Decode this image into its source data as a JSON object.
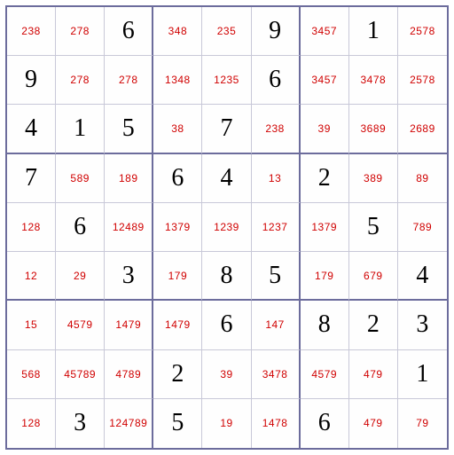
{
  "grid": [
    [
      {
        "t": "c",
        "v": "238"
      },
      {
        "t": "c",
        "v": "278"
      },
      {
        "t": "g",
        "v": "6"
      },
      {
        "t": "c",
        "v": "348"
      },
      {
        "t": "c",
        "v": "235"
      },
      {
        "t": "g",
        "v": "9"
      },
      {
        "t": "c",
        "v": "3457"
      },
      {
        "t": "g",
        "v": "1"
      },
      {
        "t": "c",
        "v": "2578"
      }
    ],
    [
      {
        "t": "g",
        "v": "9"
      },
      {
        "t": "c",
        "v": "278"
      },
      {
        "t": "c",
        "v": "278"
      },
      {
        "t": "c",
        "v": "1348"
      },
      {
        "t": "c",
        "v": "1235"
      },
      {
        "t": "g",
        "v": "6"
      },
      {
        "t": "c",
        "v": "3457"
      },
      {
        "t": "c",
        "v": "3478"
      },
      {
        "t": "c",
        "v": "2578"
      }
    ],
    [
      {
        "t": "g",
        "v": "4"
      },
      {
        "t": "g",
        "v": "1"
      },
      {
        "t": "g",
        "v": "5"
      },
      {
        "t": "c",
        "v": "38"
      },
      {
        "t": "g",
        "v": "7"
      },
      {
        "t": "c",
        "v": "238"
      },
      {
        "t": "c",
        "v": "39"
      },
      {
        "t": "c",
        "v": "3689"
      },
      {
        "t": "c",
        "v": "2689"
      }
    ],
    [
      {
        "t": "g",
        "v": "7"
      },
      {
        "t": "c",
        "v": "589"
      },
      {
        "t": "c",
        "v": "189"
      },
      {
        "t": "g",
        "v": "6"
      },
      {
        "t": "g",
        "v": "4"
      },
      {
        "t": "c",
        "v": "13"
      },
      {
        "t": "g",
        "v": "2"
      },
      {
        "t": "c",
        "v": "389"
      },
      {
        "t": "c",
        "v": "89"
      }
    ],
    [
      {
        "t": "c",
        "v": "128"
      },
      {
        "t": "g",
        "v": "6"
      },
      {
        "t": "c",
        "v": "12489"
      },
      {
        "t": "c",
        "v": "1379"
      },
      {
        "t": "c",
        "v": "1239"
      },
      {
        "t": "c",
        "v": "1237"
      },
      {
        "t": "c",
        "v": "1379"
      },
      {
        "t": "g",
        "v": "5"
      },
      {
        "t": "c",
        "v": "789"
      }
    ],
    [
      {
        "t": "c",
        "v": "12"
      },
      {
        "t": "c",
        "v": "29"
      },
      {
        "t": "g",
        "v": "3"
      },
      {
        "t": "c",
        "v": "179"
      },
      {
        "t": "g",
        "v": "8"
      },
      {
        "t": "g",
        "v": "5"
      },
      {
        "t": "c",
        "v": "179"
      },
      {
        "t": "c",
        "v": "679"
      },
      {
        "t": "g",
        "v": "4"
      }
    ],
    [
      {
        "t": "c",
        "v": "15"
      },
      {
        "t": "c",
        "v": "4579"
      },
      {
        "t": "c",
        "v": "1479"
      },
      {
        "t": "c",
        "v": "1479"
      },
      {
        "t": "g",
        "v": "6"
      },
      {
        "t": "c",
        "v": "147"
      },
      {
        "t": "g",
        "v": "8"
      },
      {
        "t": "g",
        "v": "2"
      },
      {
        "t": "g",
        "v": "3"
      }
    ],
    [
      {
        "t": "c",
        "v": "568"
      },
      {
        "t": "c",
        "v": "45789"
      },
      {
        "t": "c",
        "v": "4789"
      },
      {
        "t": "g",
        "v": "2"
      },
      {
        "t": "c",
        "v": "39"
      },
      {
        "t": "c",
        "v": "3478"
      },
      {
        "t": "c",
        "v": "4579"
      },
      {
        "t": "c",
        "v": "479"
      },
      {
        "t": "g",
        "v": "1"
      }
    ],
    [
      {
        "t": "c",
        "v": "128"
      },
      {
        "t": "g",
        "v": "3"
      },
      {
        "t": "c",
        "v": "124789"
      },
      {
        "t": "g",
        "v": "5"
      },
      {
        "t": "c",
        "v": "19"
      },
      {
        "t": "c",
        "v": "1478"
      },
      {
        "t": "g",
        "v": "6"
      },
      {
        "t": "c",
        "v": "479"
      },
      {
        "t": "c",
        "v": "79"
      }
    ]
  ]
}
